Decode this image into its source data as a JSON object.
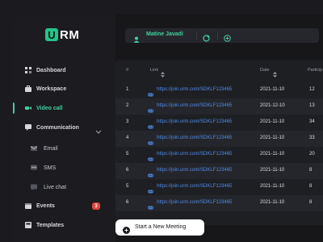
{
  "brand": {
    "logo_mark": "U",
    "logo_rest": "RM",
    "accent": "#3fd39e"
  },
  "sidebar": {
    "items": [
      {
        "label": "Dashboard",
        "icon": "grid-icon"
      },
      {
        "label": "Workspace",
        "icon": "briefcase-icon"
      },
      {
        "label": "Video call",
        "icon": "video-icon",
        "active": true
      },
      {
        "label": "Communication",
        "icon": "chat-icon",
        "expanded": true
      },
      {
        "label": "Email",
        "icon": "mail-icon",
        "sub": true
      },
      {
        "label": "SMS",
        "icon": "sms-icon",
        "sub": true
      },
      {
        "label": "Live chat",
        "icon": "live-chat-icon",
        "sub": true
      },
      {
        "label": "Events",
        "icon": "calendar-icon",
        "badge": "3"
      },
      {
        "label": "Templates",
        "icon": "template-icon"
      }
    ]
  },
  "topbar": {
    "user_name": "Matine Javadi"
  },
  "table": {
    "columns": [
      "#",
      "Link",
      "Date",
      "Particip"
    ],
    "rows": [
      {
        "num": "1",
        "link": "https://join.urm.com/SDKLF123465",
        "date": "2021-11-10",
        "part": "12"
      },
      {
        "num": "2",
        "link": "https://join.urm.com/SDKLF123465",
        "date": "2021-12-10",
        "part": "13"
      },
      {
        "num": "3",
        "link": "https://join.urm.com/SDKLF123465",
        "date": "2021-11-10",
        "part": "34"
      },
      {
        "num": "4",
        "link": "https://join.urm.com/SDKLF123465",
        "date": "2021-11-10",
        "part": "33"
      },
      {
        "num": "5",
        "link": "https://join.urm.com/SDKLF123465",
        "date": "2021-11-10",
        "part": "20"
      },
      {
        "num": "6",
        "link": "https://join.urm.com/SDKLF123465",
        "date": "2021-11-10",
        "part": "8"
      },
      {
        "num": "5",
        "link": "https://join.urm.com/SDKLF123465",
        "date": "2021-11-10",
        "part": "8"
      },
      {
        "num": "6",
        "link": "https://join.urm.com/SDKLF123465",
        "date": "2021-11-10",
        "part": "8"
      }
    ]
  },
  "actions": {
    "new_meeting_label": "Start a New Meeting"
  }
}
